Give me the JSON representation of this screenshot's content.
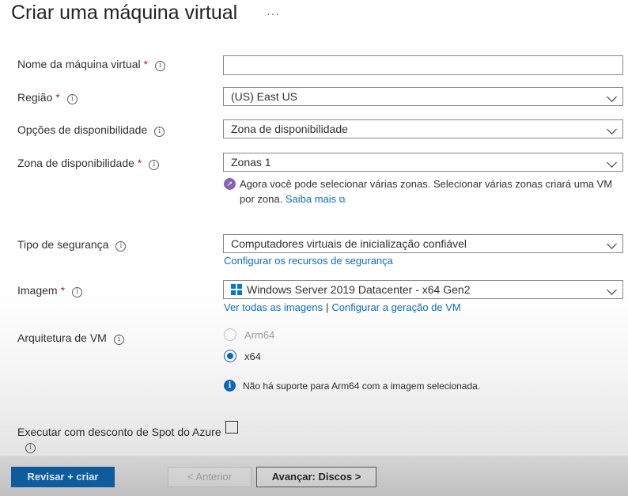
{
  "header": {
    "title": "Criar uma máquina virtual",
    "more_label": "···"
  },
  "fields": {
    "vm_name": {
      "label": "Nome da máquina virtual",
      "value": ""
    },
    "region": {
      "label": "Região",
      "value": "(US) East US"
    },
    "availability_options": {
      "label": "Opções de disponibilidade",
      "value": "Zona de disponibilidade"
    },
    "availability_zone": {
      "label": "Zona de disponibilidade",
      "value": "Zonas 1",
      "notice_text": "Agora você pode selecionar várias zonas. Selecionar várias zonas criará uma VM por zona.",
      "notice_link": "Saiba mais",
      "notice_icon": "rocket-icon"
    },
    "security_type": {
      "label": "Tipo de segurança",
      "value": "Computadores virtuais de inicialização confiável",
      "link": "Configurar os recursos de segurança"
    },
    "image": {
      "label": "Imagem",
      "value": "Windows Server 2019 Datacenter - x64 Gen2",
      "icon": "windows-logo-icon",
      "link_all": "Ver todas as imagens",
      "separator": "|",
      "link_generation": "Configurar a geração de VM"
    },
    "vm_architecture": {
      "label": "Arquitetura de VM",
      "options": [
        "Arm64",
        "x64"
      ],
      "selected": "x64",
      "info_text": "Não há suporte para Arm64 com a imagem selecionada."
    },
    "spot_discount": {
      "label": "Executar com desconto de Spot do Azure",
      "checked": false
    }
  },
  "required_mark": "*",
  "info_glyph": "i",
  "footer": {
    "review_create": "Revisar + criar",
    "previous": "< Anterior",
    "next": "Avançar: Discos >"
  },
  "colors": {
    "accent": "#0f6cbd",
    "required": "#a4262c",
    "primary_button": "#0f5c9c",
    "notice_icon": "#8764b8"
  }
}
